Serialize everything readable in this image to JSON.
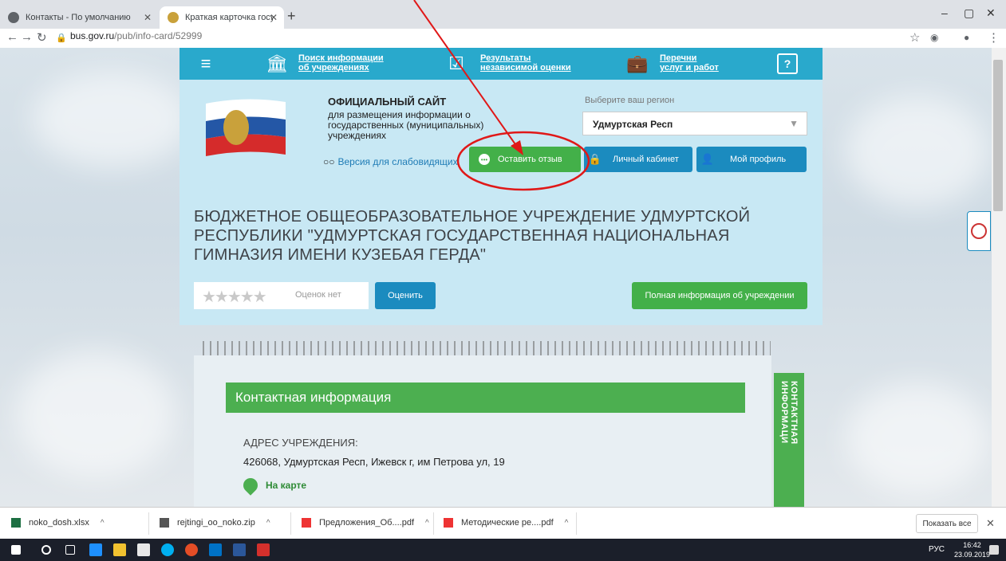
{
  "browser": {
    "tabs": [
      {
        "title": "Контакты - По умолчанию",
        "active": false
      },
      {
        "title": "Краткая карточка государствен",
        "active": true
      }
    ],
    "url_host": "bus.gov.ru",
    "url_path": "/pub/info-card/52999"
  },
  "topnav": {
    "search_l1": "Поиск информации",
    "search_l2": "об учреждениях",
    "results_l1": "Результаты",
    "results_l2": "независимой оценки",
    "lists_l1": "Перечни",
    "lists_l2": "услуг и работ",
    "help_icon": "?"
  },
  "header": {
    "title": "ОФИЦИАЛЬНЫЙ САЙТ",
    "subtitle": "для размещения информации о государственных (муниципальных) учреждениях",
    "low_vision": "Версия для слабовидящих",
    "region_label": "Выберите ваш регион",
    "region_value": "Удмуртская Респ",
    "btn_review": "Оставить отзыв",
    "btn_cabinet": "Личный кабинет",
    "btn_profile": "Мой профиль"
  },
  "org": {
    "name": "БЮДЖЕТНОЕ ОБЩЕОБРАЗОВАТЕЛЬНОЕ УЧРЕЖДЕНИЕ УДМУРТСКОЙ РЕСПУБЛИКИ \"УДМУРТСКАЯ ГОСУДАРСТВЕННАЯ НАЦИОНАЛЬНАЯ ГИМНАЗИЯ ИМЕНИ КУЗЕБАЯ ГЕРДА\"",
    "rating_text": "Оценок нет",
    "rating_stars": 0,
    "btn_rate": "Оценить",
    "btn_full_info": "Полная информация об учреждении"
  },
  "contacts": {
    "header": "Контактная информация",
    "side_tab": "КОНТАКТНАЯ ИНФОРМАЦИ",
    "address_label": "АДРЕС УЧРЕЖДЕНИЯ:",
    "address_value": "426068, Удмуртская Респ, Ижевск г, им Петрова ул, 19",
    "map_link": "На карте"
  },
  "downloads": {
    "items": [
      "noko_dosh.xlsx",
      "rejtingi_oo_noko.zip",
      "Предложения_Об....pdf",
      "Методические ре....pdf"
    ],
    "show_all": "Показать все"
  },
  "taskbar": {
    "lang": "РУС",
    "time": "16:42",
    "date": "23.09.2019"
  },
  "colors": {
    "accent_blue": "#29a9cc",
    "button_blue": "#1b8bbf",
    "accent_green": "#43b049",
    "annotation_red": "#e01818"
  }
}
